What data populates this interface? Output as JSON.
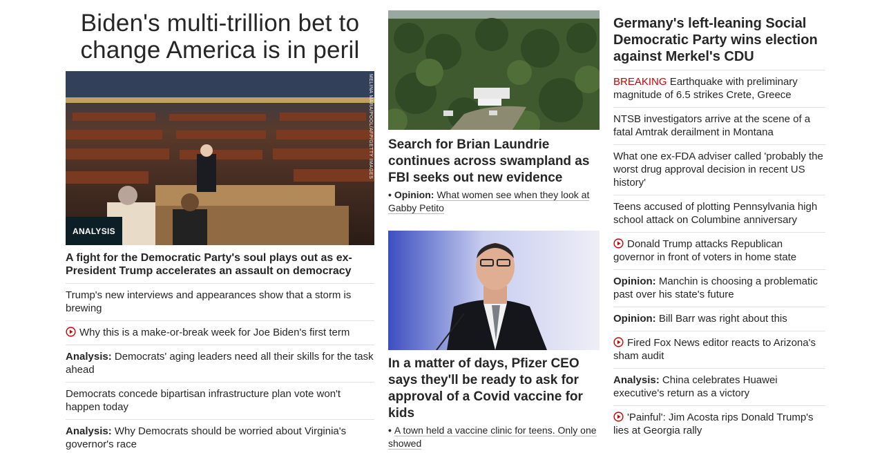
{
  "col1": {
    "headline": "Biden's multi-trillion bet to change America is in peril",
    "image_credit": "MELINA MARA/POOL/AFP/GETTY IMAGES",
    "badge": "ANALYSIS",
    "sub_headline": "A fight for the Democratic Party's soul plays out as ex-President Trump accelerates an assault on democracy",
    "items": [
      {
        "prefix": "",
        "text": "Trump's new interviews and appearances show that a storm is brewing",
        "video": false
      },
      {
        "prefix": "",
        "text": "Why this is a make-or-break week for Joe Biden's first term",
        "video": true
      },
      {
        "prefix": "Analysis:",
        "text": "Democrats' aging leaders need all their skills for the task ahead",
        "video": false
      },
      {
        "prefix": "",
        "text": "Democrats concede bipartisan infrastructure plan vote won't happen today",
        "video": false
      },
      {
        "prefix": "Analysis:",
        "text": "Why Democrats should be worried about Virginia's governor's race",
        "video": false
      }
    ]
  },
  "col2": {
    "story1": {
      "headline": "Search for Brian Laundrie continues across swampland as FBI seeks out new evidence",
      "related_prefix": "Opinion:",
      "related_text": "What women see when they look at Gabby Petito"
    },
    "story2": {
      "headline": "In a matter of days, Pfizer CEO says they'll be ready to ask for approval of a Covid vaccine for kids",
      "related_text": "A town held a vaccine clinic for teens. Only one showed"
    }
  },
  "col3": {
    "headline": "Germany's left-leaning Social Democratic Party wins election against Merkel's CDU",
    "items": [
      {
        "prefix": "BREAKING",
        "text": "Earthquake with preliminary magnitude of 6.5 strikes Crete, Greece",
        "video": false
      },
      {
        "prefix": "",
        "text": "NTSB investigators arrive at the scene of a fatal Amtrak derailment in Montana",
        "video": false
      },
      {
        "prefix": "",
        "text": "What one ex-FDA adviser called 'probably the worst drug approval decision in recent US history'",
        "video": false
      },
      {
        "prefix": "",
        "text": "Teens accused of plotting Pennsylvania high school attack on Columbine anniversary",
        "video": false
      },
      {
        "prefix": "",
        "text": "Donald Trump attacks Republican governor in front of voters in home state",
        "video": true
      },
      {
        "prefix": "Opinion:",
        "text": "Manchin is choosing a problematic past over his state's future",
        "video": false
      },
      {
        "prefix": "Opinion:",
        "text": "Bill Barr was right about this",
        "video": false
      },
      {
        "prefix": "",
        "text": "Fired Fox News editor reacts to Arizona's sham audit",
        "video": true
      },
      {
        "prefix": "Analysis:",
        "text": "China celebrates Huawei executive's return as a victory",
        "video": false
      },
      {
        "prefix": "",
        "text": "'Painful': Jim Acosta rips Donald Trump's lies at Georgia rally",
        "video": true
      }
    ]
  },
  "icons": {
    "video": "play-circle-icon"
  },
  "colors": {
    "breaking": "#cc0000",
    "text": "#262626",
    "badge_bg": "#0c1e26"
  }
}
